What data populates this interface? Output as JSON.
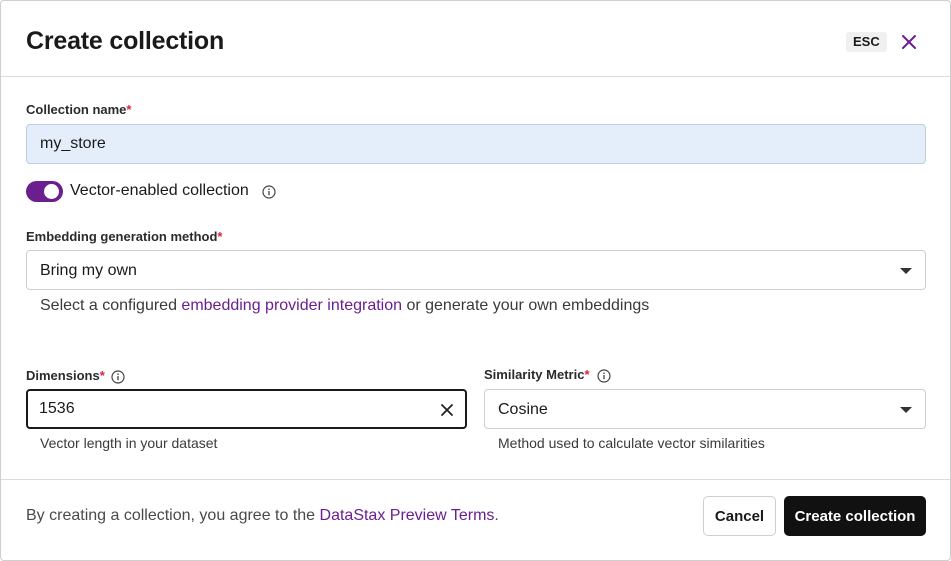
{
  "dialog": {
    "title": "Create collection",
    "esc_label": "ESC"
  },
  "form": {
    "collection_name": {
      "label": "Collection name",
      "required_mark": "*",
      "value": "my_store"
    },
    "vector_toggle": {
      "label": "Vector-enabled collection",
      "enabled": true
    },
    "embedding_method": {
      "label": "Embedding generation method",
      "required_mark": "*",
      "selected": "Bring my own",
      "helper_prefix": "Select a configured ",
      "helper_link": "embedding provider integration",
      "helper_suffix": " or generate your own embeddings"
    },
    "dimensions": {
      "label": "Dimensions",
      "required_mark": "*",
      "value": "1536",
      "helper": "Vector length in your dataset"
    },
    "similarity_metric": {
      "label": "Similarity Metric",
      "required_mark": "*",
      "selected": "Cosine",
      "helper": "Method used to calculate vector similarities"
    }
  },
  "footer": {
    "terms_prefix": "By creating a collection, you agree to the ",
    "terms_link": "DataStax Preview Terms",
    "terms_suffix": ".",
    "cancel_label": "Cancel",
    "create_label": "Create collection"
  },
  "colors": {
    "accent": "#6b1f8f",
    "required": "#d9233b",
    "primary_button": "#111111",
    "name_input_bg": "#e4eefb"
  },
  "icons": [
    "close-icon",
    "info-icon",
    "chevron-down-icon",
    "clear-icon"
  ]
}
